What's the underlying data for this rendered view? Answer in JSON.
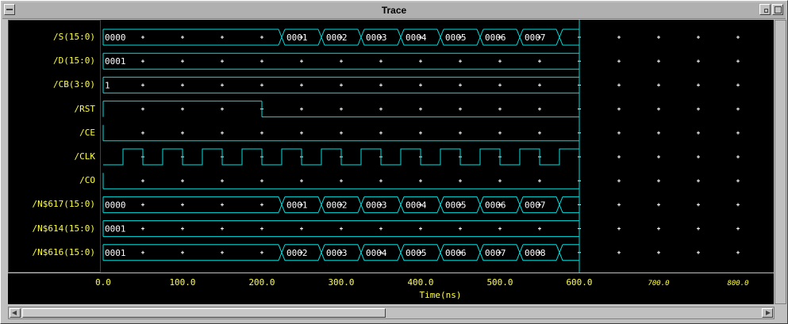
{
  "window": {
    "title": "Trace"
  },
  "colors": {
    "background": "#000000",
    "wave": "#00e0e0",
    "grid": "#ffffff",
    "text": "#ffff40"
  },
  "signals": [
    {
      "name": "/S(15:0)",
      "kind": "bus",
      "segments": [
        {
          "t": 0,
          "label": "0000"
        },
        {
          "t": 225,
          "label": "0001"
        },
        {
          "t": 275,
          "label": "0002"
        },
        {
          "t": 325,
          "label": "0003"
        },
        {
          "t": 375,
          "label": "0004"
        },
        {
          "t": 425,
          "label": "0005"
        },
        {
          "t": 475,
          "label": "0006"
        },
        {
          "t": 525,
          "label": "0007"
        },
        {
          "t": 575,
          "label": ""
        }
      ]
    },
    {
      "name": "/D(15:0)",
      "kind": "bus",
      "segments": [
        {
          "t": 0,
          "label": "0001"
        }
      ]
    },
    {
      "name": "/CB(3:0)",
      "kind": "bus",
      "segments": [
        {
          "t": 0,
          "label": "1"
        }
      ]
    },
    {
      "name": "/RST",
      "kind": "bit",
      "transitions": [
        {
          "t": 0,
          "v": 1
        },
        {
          "t": 200,
          "v": 0
        }
      ]
    },
    {
      "name": "/CE",
      "kind": "bit",
      "transitions": [
        {
          "t": 0,
          "v": 0
        }
      ]
    },
    {
      "name": "/CLK",
      "kind": "clock",
      "first_rise": 25,
      "half_period": 25
    },
    {
      "name": "/CO",
      "kind": "bit",
      "transitions": [
        {
          "t": 0,
          "v": 0
        }
      ]
    },
    {
      "name": "/N$617(15:0)",
      "kind": "bus",
      "segments": [
        {
          "t": 0,
          "label": "0000"
        },
        {
          "t": 225,
          "label": "0001"
        },
        {
          "t": 275,
          "label": "0002"
        },
        {
          "t": 325,
          "label": "0003"
        },
        {
          "t": 375,
          "label": "0004"
        },
        {
          "t": 425,
          "label": "0005"
        },
        {
          "t": 475,
          "label": "0006"
        },
        {
          "t": 525,
          "label": "0007"
        },
        {
          "t": 575,
          "label": ""
        }
      ]
    },
    {
      "name": "/N$614(15:0)",
      "kind": "bus",
      "segments": [
        {
          "t": 0,
          "label": "0001"
        }
      ]
    },
    {
      "name": "/N$616(15:0)",
      "kind": "bus",
      "segments": [
        {
          "t": 0,
          "label": "0001"
        },
        {
          "t": 225,
          "label": "0002"
        },
        {
          "t": 275,
          "label": "0003"
        },
        {
          "t": 325,
          "label": "0004"
        },
        {
          "t": 375,
          "label": "0005"
        },
        {
          "t": 425,
          "label": "0006"
        },
        {
          "t": 475,
          "label": "0007"
        },
        {
          "t": 525,
          "label": "0008"
        },
        {
          "t": 575,
          "label": ""
        }
      ]
    }
  ],
  "timeline": {
    "start": 0,
    "end": 600,
    "view_end": 850,
    "ticks": [
      "0.0",
      "100.0",
      "200.0",
      "300.0",
      "400.0",
      "500.0",
      "600.0",
      "700.0",
      "800.0"
    ],
    "tick_values": [
      0,
      100,
      200,
      300,
      400,
      500,
      600,
      700,
      800
    ],
    "label": "Time(ns)"
  }
}
